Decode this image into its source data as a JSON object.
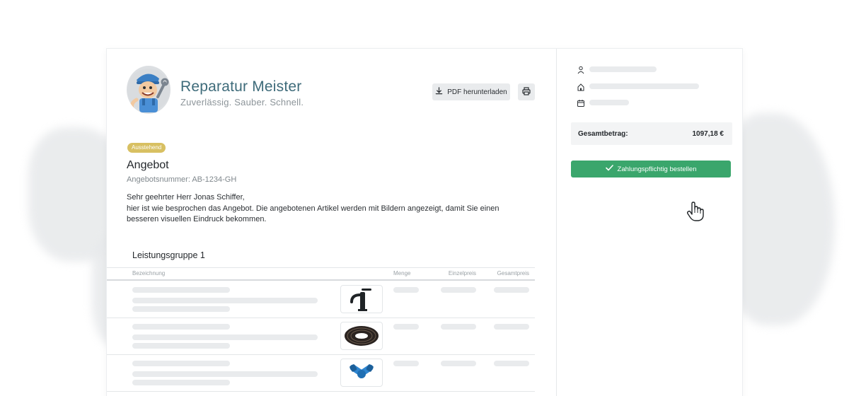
{
  "company": {
    "name": "Reparatur Meister",
    "tagline": "Zuverlässig. Sauber. Schnell."
  },
  "toolbar": {
    "pdf_label": "PDF herunterladen",
    "download_icon": "download-icon",
    "print_icon": "printer-icon"
  },
  "document": {
    "status": "Ausstehend",
    "status_color": "#d8c062",
    "title": "Angebot",
    "number": "Angebotsnummer: AB-1234-GH",
    "greeting": "Sehr geehrter Herr Jonas Schiffer,",
    "intro": "hier ist wie besprochen das Angebot. Die angebotenen Artikel werden mit Bildern angezeigt, damit Sie einen besseren visuellen Eindruck bekommen."
  },
  "table": {
    "group_title": "Leistungsgruppe 1",
    "columns": {
      "description": "Bezeichnung",
      "quantity": "Menge",
      "unit_price": "Einzelpreis",
      "total_price": "Gesamtpreis"
    },
    "rows": [
      {
        "image": "faucet"
      },
      {
        "image": "hose-coil"
      },
      {
        "image": "pipe-fitting"
      }
    ]
  },
  "sidebar": {
    "icons": [
      "person-icon",
      "home-icon",
      "calendar-icon"
    ],
    "total_label": "Gesamtbetrag:",
    "total_value": "1097,18 €",
    "order_label": "Zahlungspflichtig bestellen",
    "accent_color": "#3aa66c"
  }
}
